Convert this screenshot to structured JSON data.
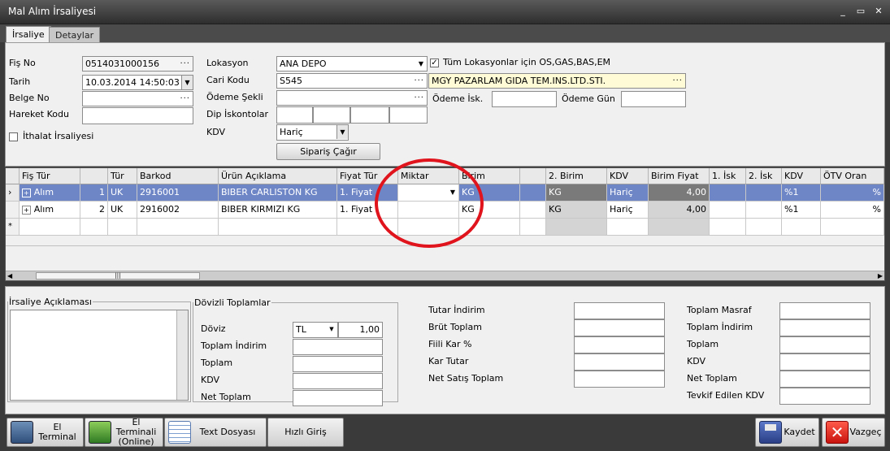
{
  "window": {
    "title": "Mal Alım İrsaliyesi",
    "min": "_",
    "max": "▭",
    "close": "✕"
  },
  "tabs": [
    "İrsaliye",
    "Detaylar"
  ],
  "form": {
    "fis_no": {
      "label": "Fiş No",
      "value": "0514031000156"
    },
    "tarih": {
      "label": "Tarih",
      "value": "10.03.2014 14:50:03"
    },
    "belge_no": {
      "label": "Belge No",
      "value": ""
    },
    "hareket_kodu": {
      "label": "Hareket Kodu",
      "value": ""
    },
    "ithalat": {
      "label": "İthalat İrsaliyesi",
      "checked": false
    },
    "lokasyon": {
      "label": "Lokasyon",
      "value": "ANA DEPO"
    },
    "tum_lokasyon": {
      "label": "Tüm Lokasyonlar için OS,GAS,BAS,EM",
      "checked": true
    },
    "cari_kodu": {
      "label": "Cari Kodu",
      "value": "S545",
      "name": "MGY PAZARLAM GIDA TEM.INS.LTD.STI."
    },
    "odeme_sekli": {
      "label": "Ödeme Şekli",
      "value": ""
    },
    "odeme_isk": {
      "label": "Ödeme İsk.",
      "value": ""
    },
    "odeme_gun": {
      "label": "Ödeme Gün",
      "value": ""
    },
    "dip_iskontolar": {
      "label": "Dip İskontolar"
    },
    "kdv": {
      "label": "KDV",
      "value": "Hariç"
    },
    "siparis_button": "Sipariş Çağır"
  },
  "grid": {
    "columns": [
      "Fiş Tür",
      "",
      "Tür",
      "Barkod",
      "Ürün Açıklama",
      "Fiyat Tür",
      "Miktar",
      "Birim",
      "",
      "2. Birim",
      "KDV",
      "Birim Fiyat",
      "1. İsk",
      "2. İsk",
      "KDV",
      "ÖTV Oran"
    ],
    "rows": [
      [
        "Alım",
        "1",
        "UK",
        "2916001",
        "BIBER CARLISTON KG",
        "1. Fiyat",
        "",
        "KG",
        "",
        "KG",
        "Hariç",
        "4,00",
        "",
        "",
        "%1",
        "%"
      ],
      [
        "Alım",
        "2",
        "UK",
        "2916002",
        "BIBER KIRMIZI KG",
        "1. Fiyat",
        "",
        "KG",
        "",
        "KG",
        "Hariç",
        "4,00",
        "",
        "",
        "%1",
        "%"
      ]
    ],
    "new_row_marker": "*",
    "scroll_grip": "|||"
  },
  "aciklama": {
    "label": "İrsaliye Açıklaması"
  },
  "dovizli": {
    "legend": "Dövizli Toplamlar",
    "doviz_label": "Döviz",
    "doviz_value": "TL",
    "kur": "1,00",
    "labels": [
      "Toplam İndirim",
      "Toplam",
      "KDV",
      "Net Toplam"
    ]
  },
  "mid_totals": [
    "Tutar İndirim",
    "Brüt Toplam",
    "Fiili Kar %",
    "Kar Tutar",
    "Net Satış Toplam"
  ],
  "right_totals": [
    "Toplam Masraf",
    "Toplam İndirim",
    "Toplam",
    "KDV",
    "Net Toplam",
    "Tevkif Edilen KDV"
  ],
  "toolbar": {
    "el_terminal": "El Terminal",
    "el_terminal_online": "El Terminali\n(Online)",
    "text_dosyasi": "Text Dosyası",
    "hizli_giris": "Hızlı Giriş",
    "kaydet": "Kaydet",
    "vazgec": "Vazgeç"
  },
  "colors": {
    "selected_row": "#6f86c6",
    "highlight_circle": "#e0141d",
    "cari_name_bg": "#fffbd6"
  }
}
